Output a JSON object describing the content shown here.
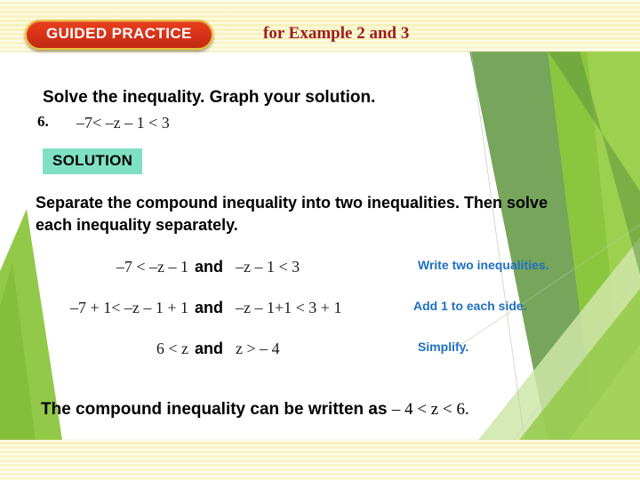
{
  "header": {
    "badge_label": "GUIDED PRACTICE",
    "subtitle": "for Example 2 and 3"
  },
  "body": {
    "prompt": "Solve the inequality. Graph your solution.",
    "problem_number": "6.",
    "problem_expression": "–7< –z – 1 < 3",
    "solution_label": "SOLUTION",
    "explanation": "Separate the compound inequality into two inequalities. Then solve each inequality separately.",
    "conjunction": "and",
    "steps": [
      {
        "left": "–7 < –z – 1",
        "conjunction": "and",
        "right": "–z – 1 < 3",
        "note": "Write two inequalities."
      },
      {
        "left": "–7 + 1< –z – 1 + 1",
        "conjunction": "and",
        "right": "–z – 1+1 < 3 + 1",
        "note": "Add 1 to each side."
      },
      {
        "left": "6 < z",
        "conjunction": "and",
        "right": "z > – 4",
        "note": "Simplify."
      }
    ],
    "conclusion_lead": "The compound inequality can be written as",
    "conclusion_result": "– 4 < z < 6."
  },
  "colors": {
    "badge_fill": "#d9331a",
    "badge_border": "#e8c23c",
    "subtitle_text": "#9e1b16",
    "solution_highlight": "#7fe0c3",
    "note_blue": "#1f6fc4",
    "band_cream": "#f7f2c0",
    "green_dark": "#6fa052",
    "green_bright": "#8cc63e",
    "green_light": "#cfe6a8"
  }
}
